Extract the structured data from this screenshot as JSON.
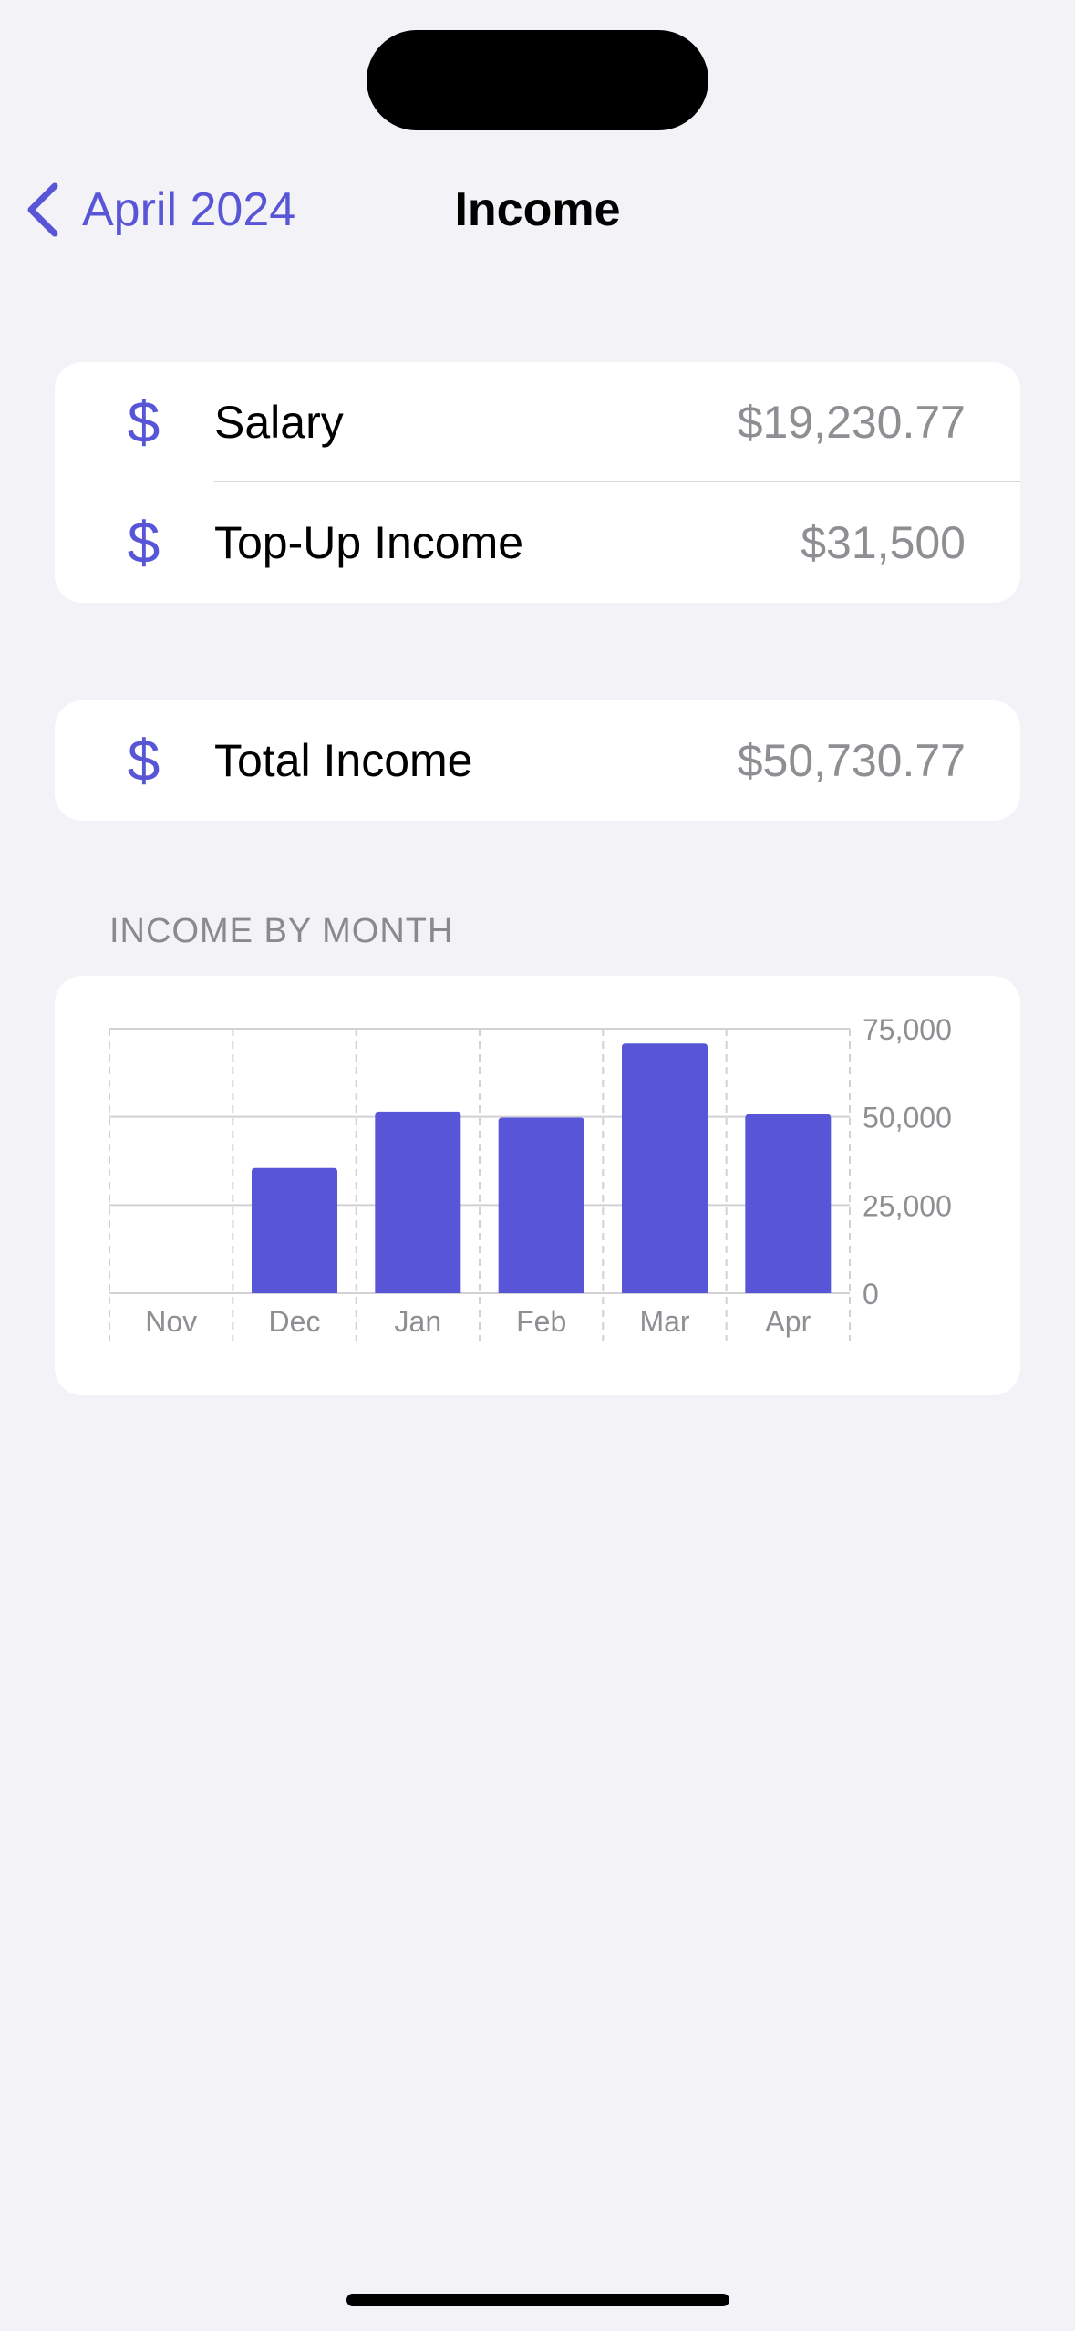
{
  "nav": {
    "back_label": "April 2024",
    "title": "Income"
  },
  "income_items": [
    {
      "icon": "dollar-icon",
      "label": "Salary",
      "value": "$19,230.77"
    },
    {
      "icon": "dollar-icon",
      "label": "Top-Up Income",
      "value": "$31,500"
    }
  ],
  "total": {
    "icon": "dollar-icon",
    "label": "Total Income",
    "value": "$50,730.77"
  },
  "chart_section": {
    "header": "INCOME BY MONTH"
  },
  "colors": {
    "accent": "#5856d6",
    "background": "#f2f2f7",
    "secondary_text": "#8e8e93"
  },
  "chart_data": {
    "type": "bar",
    "categories": [
      "Nov",
      "Dec",
      "Jan",
      "Feb",
      "Mar",
      "Apr"
    ],
    "values": [
      0,
      35500,
      51500,
      49800,
      70800,
      50730.77
    ],
    "ylim": [
      0,
      75000
    ],
    "yticks": [
      0,
      25000,
      50000,
      75000
    ],
    "ytick_labels": [
      "0",
      "25,000",
      "50,000",
      "75,000"
    ],
    "y_axis_position": "right",
    "grid": true,
    "bar_color": "#5856d6"
  }
}
